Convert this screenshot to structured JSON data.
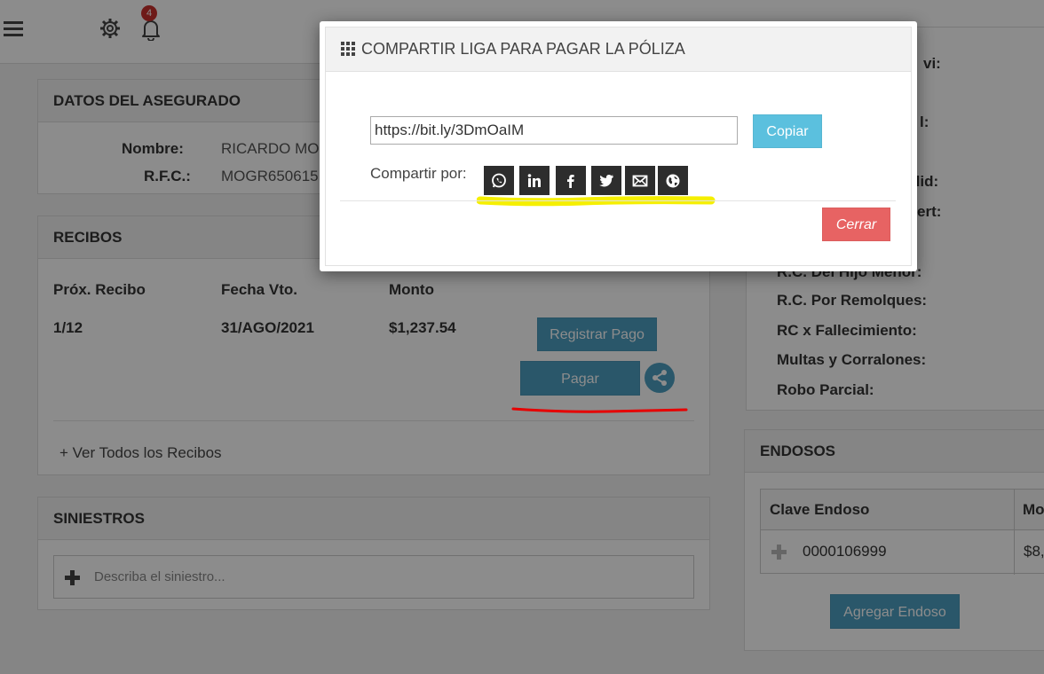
{
  "header": {
    "notifications_count": "4"
  },
  "asegurado": {
    "title": "DATOS DEL ASEGURADO",
    "nombre_label": "Nombre:",
    "nombre_value": "RICARDO MO",
    "rfc_label": "R.F.C.:",
    "rfc_value": "MOGR650615"
  },
  "recibos": {
    "title": "RECIBOS",
    "columns": [
      "Próx. Recibo",
      "Fecha Vto.",
      "Monto"
    ],
    "row": {
      "recibo": "1/12",
      "fecha": "31/AGO/2021",
      "monto": "$1,237.54"
    },
    "registrar_label": "Registrar Pago",
    "pagar_label": "Pagar",
    "ver_todos": "+ Ver Todos los Recibos"
  },
  "siniestros": {
    "title": "SINIESTROS",
    "placeholder": "Describa el siniestro..."
  },
  "coberturas": {
    "partial_top": [
      "vi:",
      "l:",
      "did:",
      "ert:"
    ],
    "items": [
      "R.C. Del Hijo Menor:",
      "R.C. Por Remolques:",
      "RC x Fallecimiento:",
      "Multas y Corralones:",
      "Robo Parcial:"
    ]
  },
  "endosos": {
    "title": "ENDOSOS",
    "columns": [
      "Clave Endoso",
      "Mo"
    ],
    "row": {
      "clave": "0000106999",
      "monto": "$8,"
    },
    "agregar_label": "Agregar Endoso"
  },
  "modal": {
    "title": "COMPARTIR LIGA PARA PAGAR LA PÓLIZA",
    "url": "https://bit.ly/3DmOaIM",
    "copiar_label": "Copiar",
    "compartir_label": "Compartir por:",
    "share_icons": [
      "whatsapp-icon",
      "linkedin-icon",
      "facebook-icon",
      "twitter-icon",
      "email-icon",
      "web-icon"
    ],
    "cerrar_label": "Cerrar"
  },
  "colors": {
    "primary_btn": "#4d9fc1",
    "copiar_btn": "#5bc0de",
    "cerrar_btn": "#e76363",
    "highlight_yellow": "#f5ef00",
    "underline_red": "#e60000"
  }
}
